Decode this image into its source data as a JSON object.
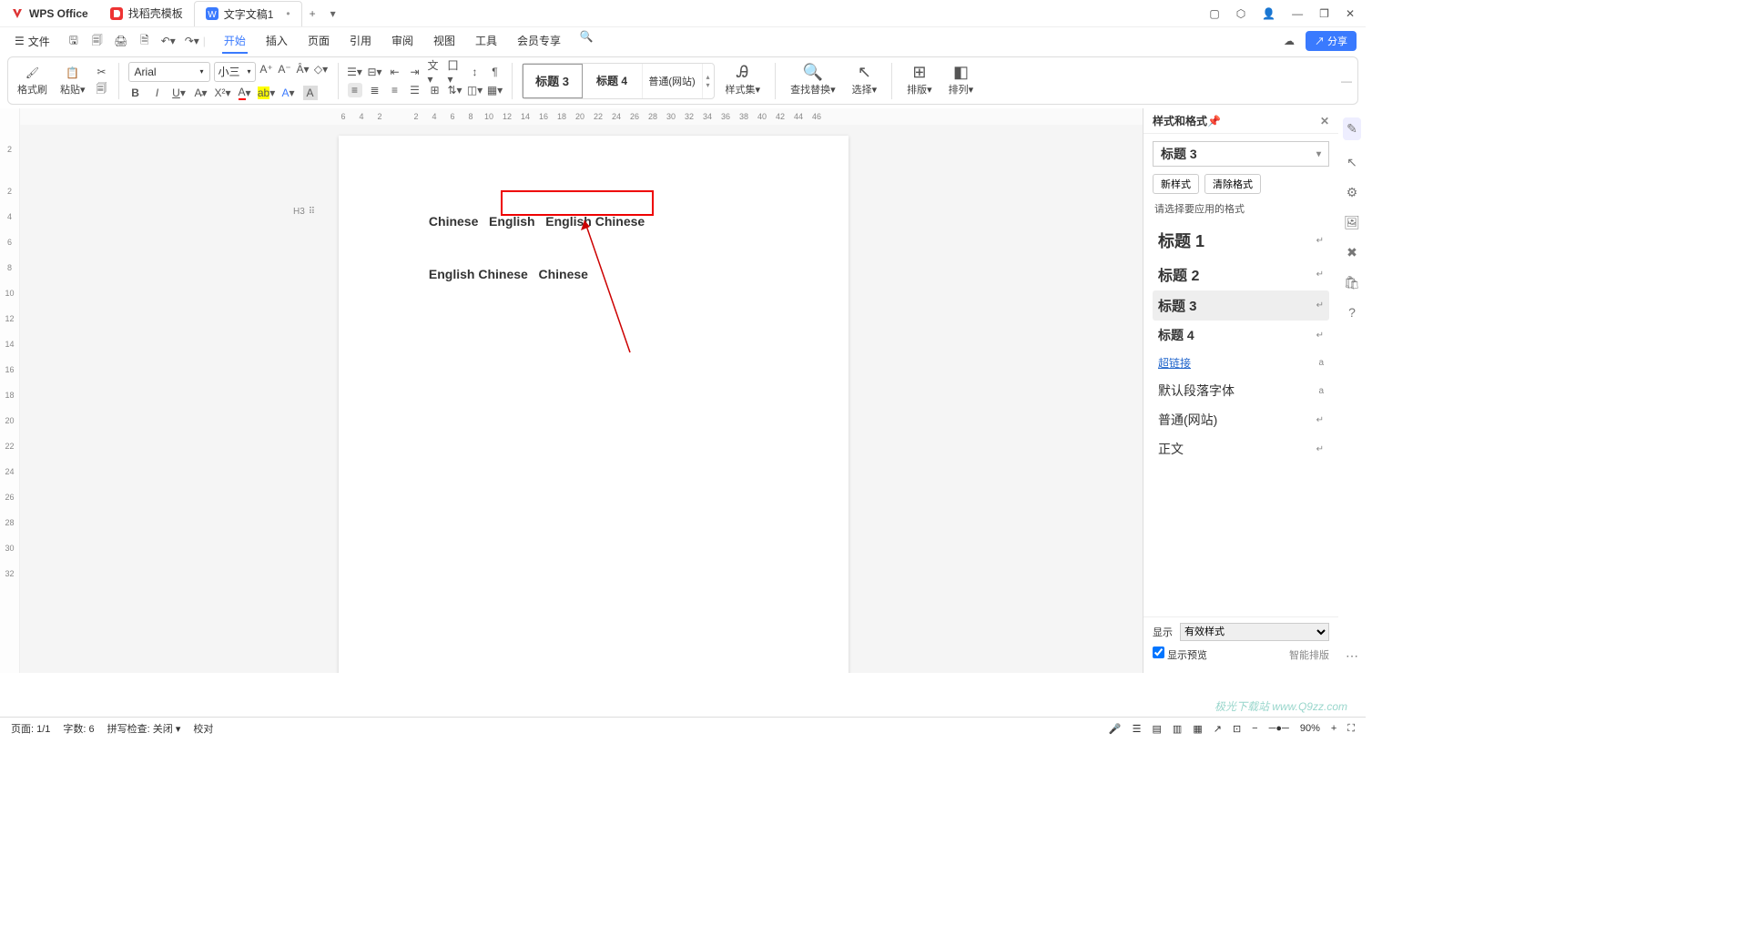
{
  "titlebar": {
    "app_name": "WPS Office",
    "tabs": [
      {
        "label": "找稻壳模板"
      },
      {
        "label": "文字文稿1"
      }
    ]
  },
  "menubar": {
    "file": "文件",
    "items": [
      "开始",
      "插入",
      "页面",
      "引用",
      "审阅",
      "视图",
      "工具",
      "会员专享"
    ],
    "share": "分享"
  },
  "ribbon": {
    "format_brush": "格式刷",
    "paste": "粘贴",
    "font": "Arial",
    "size": "小三",
    "style_h3": "标题 3",
    "style_h4": "标题 4",
    "style_web": "普通(网站)",
    "style_set": "样式集",
    "find_replace": "查找替换",
    "select": "选择",
    "layout": "排版",
    "arrange": "排列"
  },
  "hruler": [
    "6",
    "4",
    "2",
    "",
    "2",
    "4",
    "6",
    "8",
    "10",
    "12",
    "14",
    "16",
    "18",
    "20",
    "22",
    "24",
    "26",
    "28",
    "30",
    "32",
    "34",
    "36",
    "38",
    "40",
    "42",
    "44",
    "46"
  ],
  "vruler": [
    "2",
    "",
    "2",
    "4",
    "6",
    "8",
    "10",
    "12",
    "14",
    "16",
    "18",
    "20",
    "22",
    "24",
    "26",
    "28",
    "30",
    "32"
  ],
  "document": {
    "line1": "Chinese   English   English Chinese",
    "line2": "English Chinese   Chinese",
    "h3_badge": "H3"
  },
  "panel": {
    "title": "样式和格式",
    "current_style": "标题 3",
    "new_style": "新样式",
    "clear_format": "清除格式",
    "hint": "请选择要应用的格式",
    "styles": [
      {
        "name": "标题 1",
        "cls": "h1",
        "mark": "↵"
      },
      {
        "name": "标题 2",
        "cls": "h2",
        "mark": "↵"
      },
      {
        "name": "标题 3",
        "cls": "h3",
        "mark": "↵",
        "selected": true
      },
      {
        "name": "标题 4",
        "cls": "h4",
        "mark": "↵"
      },
      {
        "name": "超链接",
        "cls": "link",
        "mark": "a"
      },
      {
        "name": "默认段落字体",
        "cls": "",
        "mark": "a"
      },
      {
        "name": "普通(网站)",
        "cls": "",
        "mark": "↵"
      },
      {
        "name": "正文",
        "cls": "",
        "mark": "↵"
      }
    ],
    "show_label": "显示",
    "show_value": "有效样式",
    "preview": "显示预览",
    "smart": "智能排版"
  },
  "statusbar": {
    "page": "页面: 1/1",
    "words": "字数: 6",
    "spell": "拼写检查: 关闭",
    "proof": "校对",
    "zoom": "90%"
  },
  "watermark": "极光下载站 www.Q9zz.com"
}
